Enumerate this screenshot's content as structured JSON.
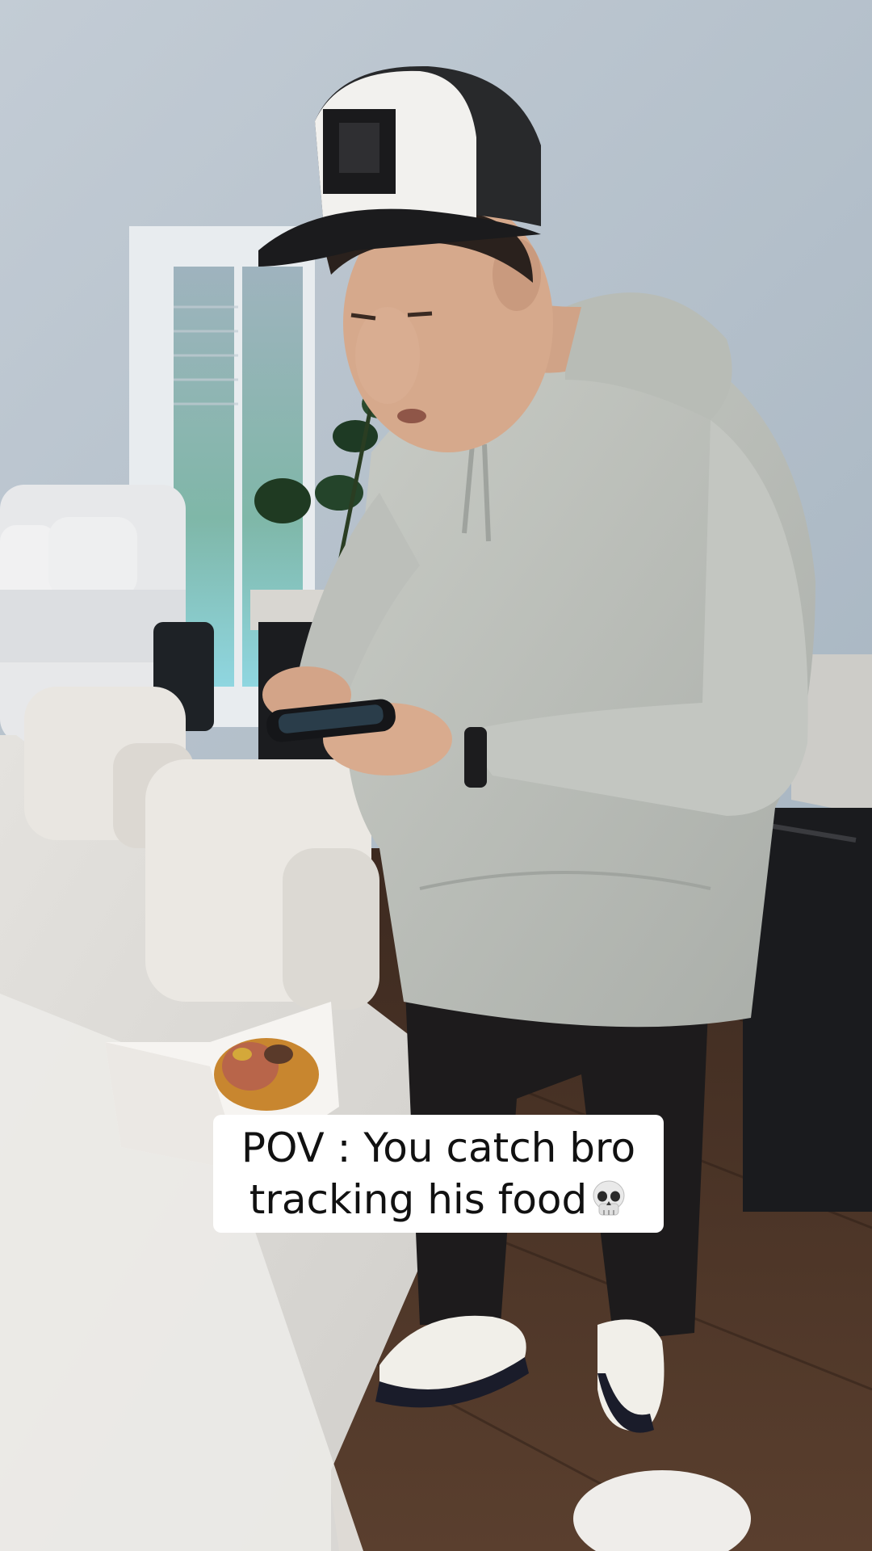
{
  "caption": {
    "line1": "POV : You catch bro",
    "line2": "tracking his food",
    "emoji": "skull-emoji"
  },
  "scene": {
    "description_icons": [
      "trucker-cap",
      "phone",
      "watch",
      "sneakers",
      "food-tray"
    ],
    "colors": {
      "wall": "#b7c4cf",
      "hoodie": "#bfc3bd",
      "pants": "#1d1b1c",
      "floor": "#4a3326",
      "table": "#dedcd8",
      "caption_bg": "#ffffff",
      "caption_text": "#111111"
    }
  }
}
